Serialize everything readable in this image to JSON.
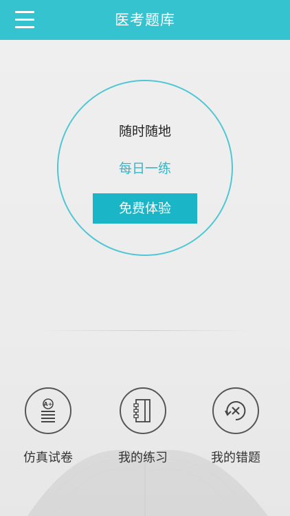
{
  "header": {
    "title": "医考题库",
    "menu_icon": "hamburger-menu-icon"
  },
  "hero": {
    "slogan_line1": "随时随地",
    "slogan_line2": "每日一练",
    "trial_button": "免费体验",
    "accent_color": "#35c3cf"
  },
  "actions": [
    {
      "label": "仿真试卷",
      "icon": "exam-paper-icon"
    },
    {
      "label": "我的练习",
      "icon": "notebook-icon"
    },
    {
      "label": "我的错题",
      "icon": "wrong-questions-icon"
    }
  ],
  "exam_icon_badge": "A+"
}
